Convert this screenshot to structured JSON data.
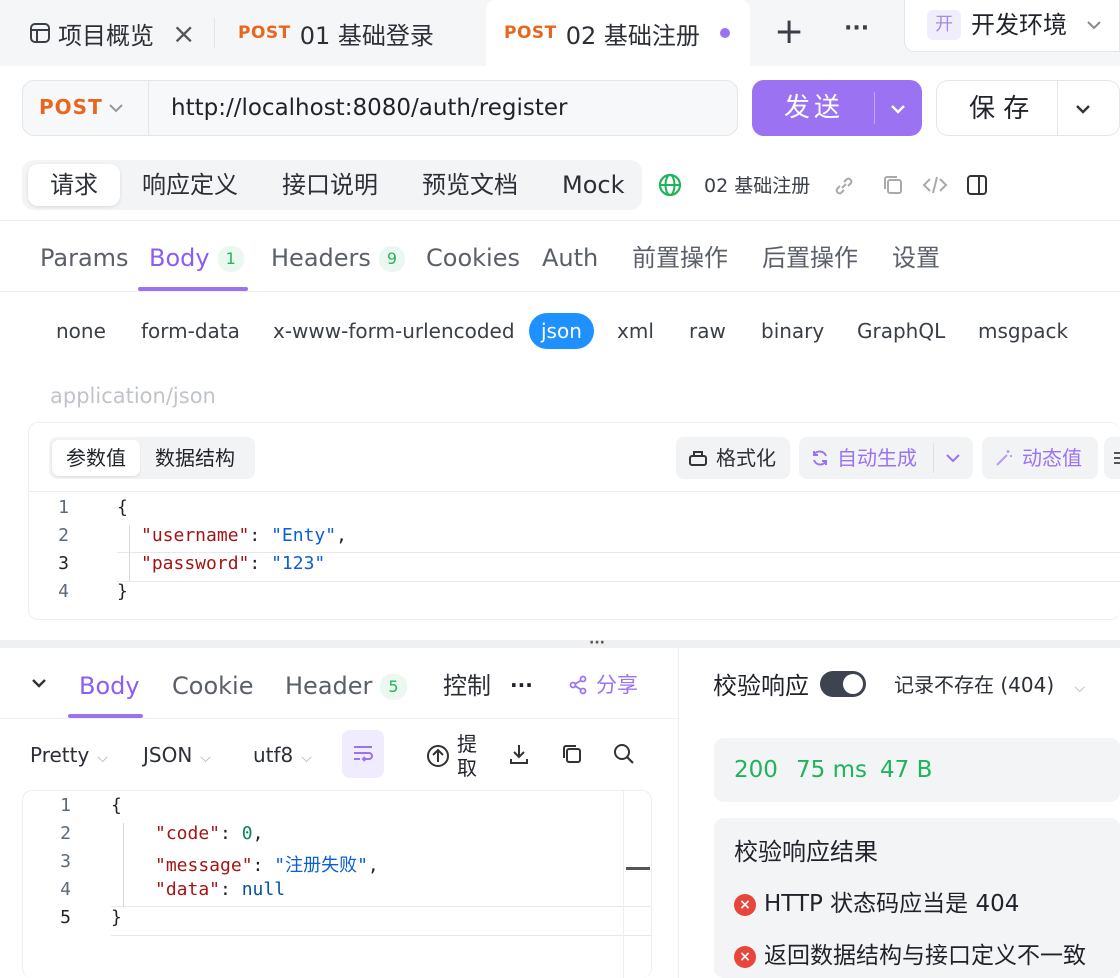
{
  "tabs": [
    {
      "icon": "project-overview-icon",
      "label": "项目概览",
      "close": "×"
    },
    {
      "method": "POST",
      "label": "01 基础登录"
    },
    {
      "method": "POST",
      "label": "02 基础注册"
    }
  ],
  "tab_actions": {
    "add": "+",
    "more": "···"
  },
  "env": {
    "badge": "开",
    "label": "开发环境"
  },
  "request": {
    "method": "POST",
    "url": "http://localhost:8080/auth/register"
  },
  "send_label": "发送",
  "save_label": "保 存",
  "seg_tabs": [
    "请求",
    "响应定义",
    "接口说明",
    "预览文档",
    "Mock"
  ],
  "api_name": "02 基础注册",
  "param_tabs": [
    {
      "label": "Params"
    },
    {
      "label": "Body",
      "count": "1"
    },
    {
      "label": "Headers",
      "count": "9"
    },
    {
      "label": "Cookies"
    },
    {
      "label": "Auth"
    },
    {
      "label": "前置操作"
    },
    {
      "label": "后置操作"
    },
    {
      "label": "设置"
    }
  ],
  "body_types": [
    "none",
    "form-data",
    "x-www-form-urlencoded",
    "json",
    "xml",
    "raw",
    "binary",
    "GraphQL",
    "msgpack"
  ],
  "content_type": "application/json",
  "editor_tabs": [
    "参数值",
    "数据结构"
  ],
  "editor_tools": {
    "format": "格式化",
    "autogen": "自动生成",
    "dynamic": "动态值"
  },
  "request_body_lines": [
    {
      "n": "1",
      "text": "{"
    },
    {
      "n": "2",
      "key": "\"username\"",
      "val": "\"Enty\"",
      "tail": ","
    },
    {
      "n": "3",
      "key": "\"password\"",
      "val": "\"123\"",
      "tail": ""
    },
    {
      "n": "4",
      "text": "}"
    }
  ],
  "resize_handle": "···",
  "resp_tabs": [
    {
      "label": "Body"
    },
    {
      "label": "Cookie"
    },
    {
      "label": "Header",
      "count": "5"
    },
    {
      "label": "控制"
    }
  ],
  "resp_more": "···",
  "share": "分享",
  "validate": {
    "label": "校验响应",
    "enabled": true,
    "select": "记录不存在 (404)"
  },
  "resp_tools": {
    "pretty": "Pretty",
    "format": "JSON",
    "encoding": "utf8",
    "extract": "提取"
  },
  "response_lines": [
    {
      "n": "1",
      "text": "{"
    },
    {
      "n": "2",
      "key": "\"code\"",
      "val": "0",
      "type": "num",
      "tail": ","
    },
    {
      "n": "3",
      "key": "\"message\"",
      "val": "\"注册失败\"",
      "type": "str",
      "tail": ","
    },
    {
      "n": "4",
      "key": "\"data\"",
      "val": "null",
      "type": "nul",
      "tail": ""
    },
    {
      "n": "5",
      "text": "}"
    }
  ],
  "status": {
    "code": "200",
    "time": "75 ms",
    "size": "47 B"
  },
  "validation": {
    "title": "校验响应结果",
    "errors": [
      "HTTP 状态码应当是 404",
      "返回数据结构与接口定义不一致"
    ]
  }
}
